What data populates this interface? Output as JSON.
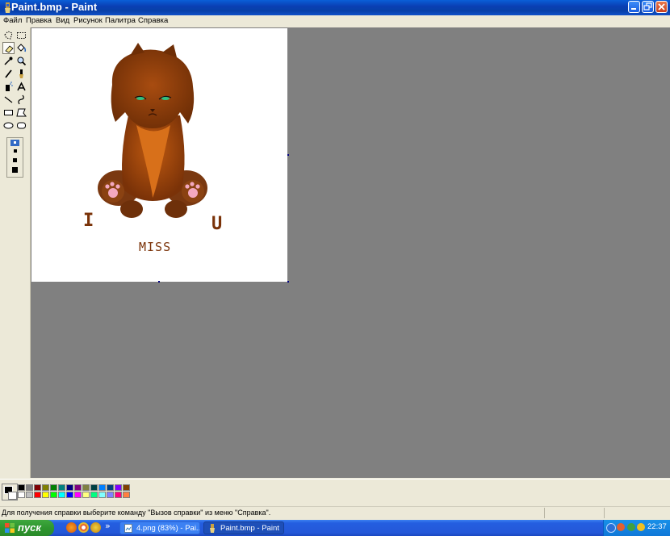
{
  "window": {
    "title": "Paint.bmp - Paint",
    "controls": [
      "minimize",
      "maximize",
      "close"
    ]
  },
  "menu": {
    "items": [
      "Файл",
      "Правка",
      "Вид",
      "Рисунок",
      "Палитра",
      "Справка"
    ]
  },
  "toolbox": {
    "tools": [
      "free-form-select",
      "select",
      "eraser",
      "fill",
      "pick-color",
      "magnifier",
      "pencil",
      "brush",
      "airbrush",
      "text",
      "line",
      "curve",
      "rectangle",
      "polygon",
      "ellipse",
      "rounded-rectangle"
    ],
    "selected_tool": "eraser"
  },
  "canvas": {
    "text_left": "I",
    "text_right": "U",
    "text_bottom": "MISS"
  },
  "palette": {
    "foreground": "#000000",
    "background": "#ffffff",
    "colors_row1": [
      "#000000",
      "#808080",
      "#800000",
      "#808000",
      "#008000",
      "#008080",
      "#000080",
      "#800080",
      "#808040",
      "#004040",
      "#0080ff",
      "#004080",
      "#8000ff",
      "#804000"
    ],
    "colors_row2": [
      "#ffffff",
      "#c0c0c0",
      "#ff0000",
      "#ffff00",
      "#00ff00",
      "#00ffff",
      "#0000ff",
      "#ff00ff",
      "#ffff80",
      "#00ff80",
      "#80ffff",
      "#8080ff",
      "#ff0080",
      "#ff8040"
    ]
  },
  "status": {
    "help_text": "Для получения справки выберите команду \"Вызов справки\" из меню \"Справка\"."
  },
  "taskbar": {
    "start_label": "пуск",
    "more_label": "»",
    "buttons": [
      "4.png (83%) - Pai...",
      "Paint.bmp - Paint"
    ],
    "clock": "22:37"
  }
}
